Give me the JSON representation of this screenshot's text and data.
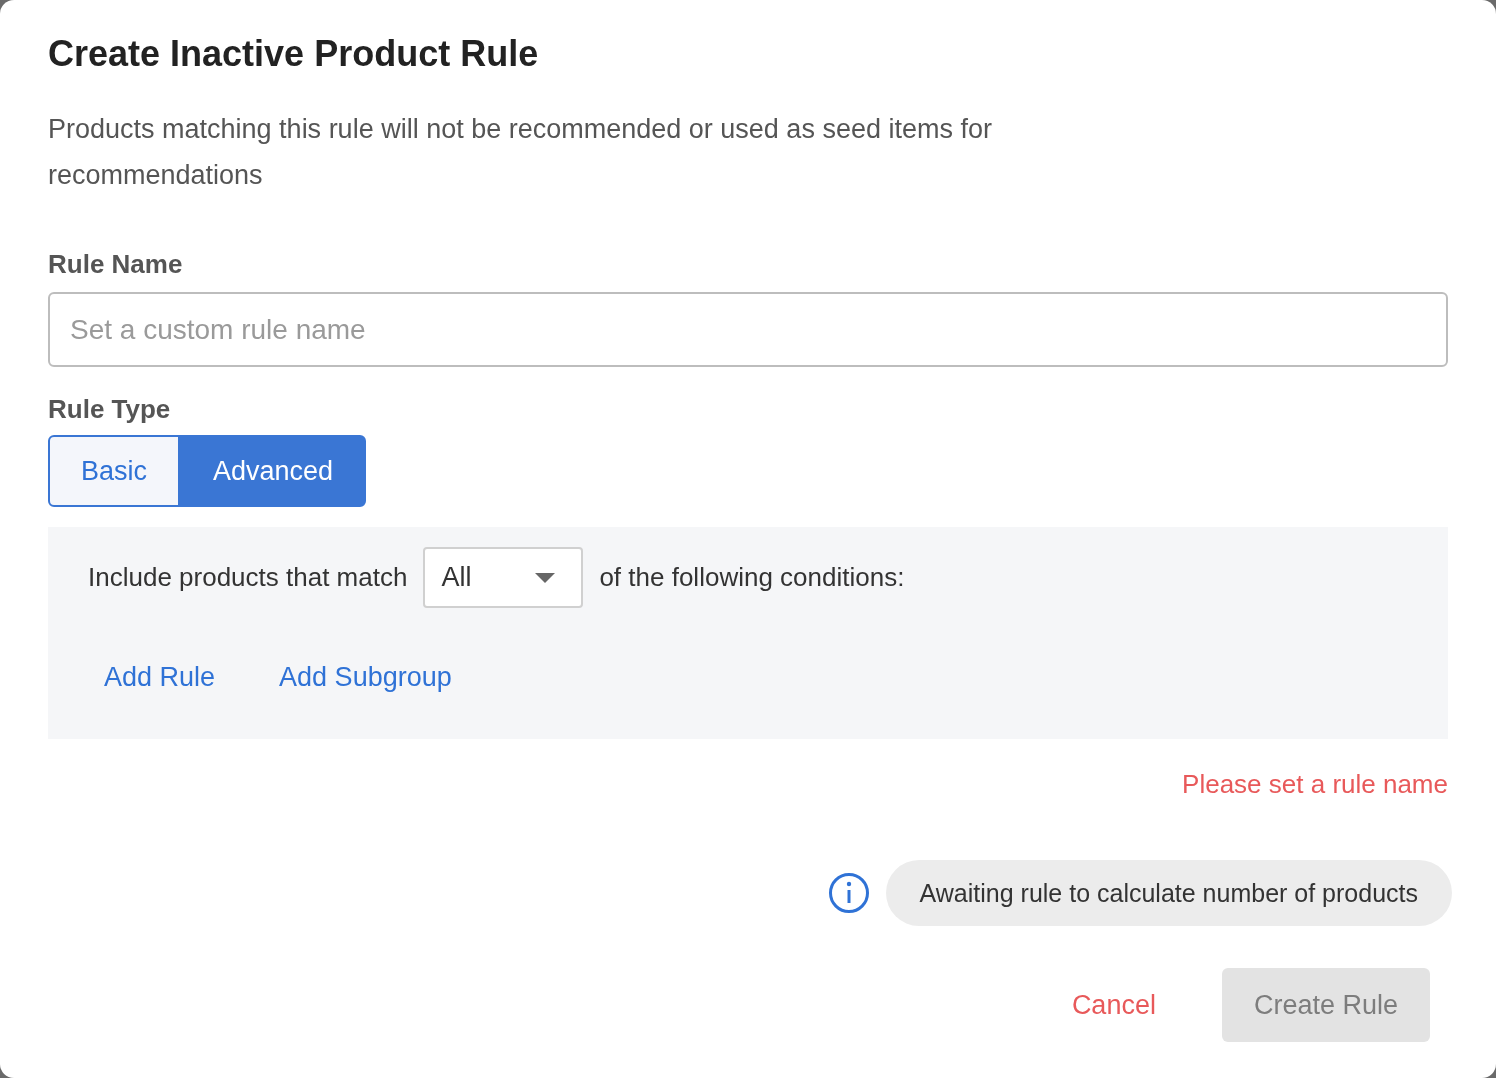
{
  "dialog": {
    "title": "Create Inactive Product Rule",
    "description": "Products matching this rule will not be recommended or used as seed items for recommendations"
  },
  "rule_name": {
    "label": "Rule Name",
    "placeholder": "Set a custom rule name"
  },
  "rule_type": {
    "label": "Rule Type",
    "options": [
      {
        "label": "Basic",
        "selected": false
      },
      {
        "label": "Advanced",
        "selected": true
      }
    ]
  },
  "conditions": {
    "prefix": "Include products that match",
    "match": "All",
    "suffix": "of the following conditions:",
    "actions": [
      "Add Rule",
      "Add Subgroup"
    ]
  },
  "error": "Please set a rule name",
  "product_count": "Awaiting rule to calculate number of products",
  "buttons": [
    {
      "label": "Cancel",
      "kind": "cancel",
      "disabled": false
    },
    {
      "label": "Create Rule",
      "kind": "primary",
      "disabled": true
    }
  ]
}
